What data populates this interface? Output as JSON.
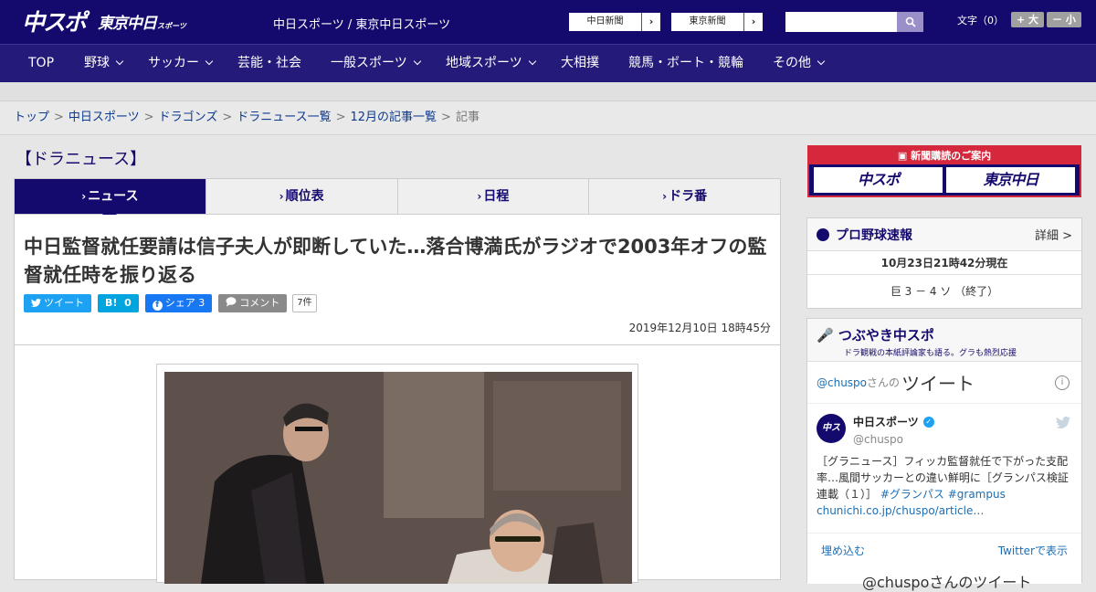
{
  "header": {
    "logo_main": "中スポ",
    "logo_sub": "東京中日",
    "logo_small": "スポーツ",
    "site_title": "中日スポーツ / 東京中日スポーツ",
    "paper_links": [
      "中日新聞",
      "東京新聞"
    ],
    "search_placeholder": "",
    "font_size_label": "文字（0）",
    "font_larger": "+ 大",
    "font_smaller": "－ 小"
  },
  "nav": {
    "items": [
      "TOP",
      "野球",
      "サッカー",
      "芸能・社会",
      "一般スポーツ",
      "地域スポーツ",
      "大相撲",
      "競馬・ボート・競輪",
      "その他"
    ]
  },
  "breadcrumb": {
    "items": [
      "トップ",
      "中日スポーツ",
      "ドラゴンズ",
      "ドラニュース一覧",
      "12月の記事一覧"
    ],
    "current": "記事",
    "separator": ">"
  },
  "section": {
    "title": "【ドラニュース】",
    "tabs": [
      "ニュース",
      "順位表",
      "日程",
      "ドラ番"
    ],
    "active_tab": "ニュース"
  },
  "article": {
    "headline": "中日監督就任要請は信子夫人が即断していた…落合博満氏がラジオで2003年オフの監督就任時を振り返る",
    "share": {
      "tweet": "ツイート",
      "hatena": "B!",
      "hatena_count": "0",
      "facebook": "シェア",
      "facebook_count": "3",
      "comment": "コメント",
      "comment_count": "7件"
    },
    "date": "2019年12月10日 18時45分"
  },
  "sidebar": {
    "banner": {
      "title": "新聞購読のご案内",
      "logo_left": "中スポ",
      "logo_right": "東京中日"
    },
    "baseball": {
      "title": "プロ野球速報",
      "more": "詳細 >",
      "updated": "10月23日21時42分現在",
      "score": "巨 3 － 4 ソ （終了）"
    },
    "tsubuyaki": {
      "title": "つぶやき中スポ",
      "subtitle": "ドラ観戦の本紙評論家も語る。グラも熱烈応援",
      "tweets_user": "@chuspo",
      "tweets_suffix": "さんの",
      "tweets_label": "ツイート",
      "account_name": "中日スポーツ",
      "account_handle": "@chuspo",
      "tweet_text": "［グラニュース］フィッカ監督就任で下がった支配率…風間サッカーとの違い鮮明に［グランパス検証連載（１）］",
      "tweet_tags": "#グランパス #grampus",
      "tweet_link": "chunichi.co.jp/chuspo/article…",
      "embed": "埋め込む",
      "view_on_twitter": "Twitterで表示",
      "more_tweets": "@chuspoさんのツイート"
    }
  },
  "colors": {
    "header_bg": "#140a6e",
    "nav_bg": "#231a7a",
    "accent_red": "#d6283d",
    "twitter_blue": "#1da1f2"
  }
}
